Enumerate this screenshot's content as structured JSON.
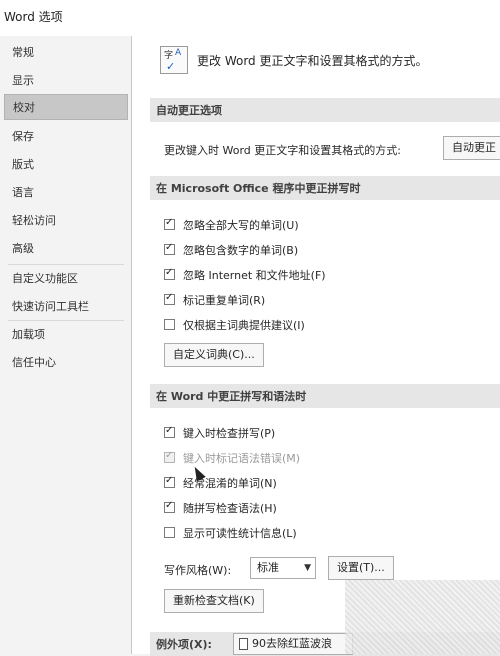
{
  "window": {
    "title": "Word 选项"
  },
  "sidebar": {
    "items": [
      {
        "label": "常规"
      },
      {
        "label": "显示"
      },
      {
        "label": "校对"
      },
      {
        "label": "保存"
      },
      {
        "label": "版式"
      },
      {
        "label": "语言"
      },
      {
        "label": "轻松访问"
      },
      {
        "label": "高级"
      },
      {
        "label": "自定义功能区"
      },
      {
        "label": "快速访问工具栏"
      },
      {
        "label": "加载项"
      },
      {
        "label": "信任中心"
      }
    ],
    "selected": "校对"
  },
  "header": {
    "text": "更改 Word 更正文字和设置其格式的方式。",
    "icon": "proofing-abc-check-icon"
  },
  "autocorrect": {
    "title": "自动更正选项",
    "description": "更改键入时 Word 更正文字和设置其格式的方式:",
    "button": "自动更正"
  },
  "office": {
    "title": "在 Microsoft Office 程序中更正拼写时",
    "options": [
      {
        "label": "忽略全部大写的单词(U)",
        "checked": true
      },
      {
        "label": "忽略包含数字的单词(B)",
        "checked": true
      },
      {
        "label": "忽略 Internet 和文件地址(F)",
        "checked": true
      },
      {
        "label": "标记重复单词(R)",
        "checked": true
      },
      {
        "label": "仅根据主词典提供建议(I)",
        "checked": false
      }
    ],
    "custom_dict_button": "自定义词典(C)..."
  },
  "word": {
    "title": "在 Word 中更正拼写和语法时",
    "options": [
      {
        "label": "键入时检查拼写(P)",
        "checked": true,
        "disabled": false
      },
      {
        "label": "键入时标记语法错误(M)",
        "checked": true,
        "disabled": true
      },
      {
        "label": "经常混淆的单词(N)",
        "checked": true,
        "disabled": false
      },
      {
        "label": "随拼写检查语法(H)",
        "checked": true,
        "disabled": false
      },
      {
        "label": "显示可读性统计信息(L)",
        "checked": false,
        "disabled": false
      }
    ],
    "style_label": "写作风格(W):",
    "style_value": "标准",
    "settings_button": "设置(T)...",
    "recheck_button": "重新检查文档(K)"
  },
  "exceptions": {
    "label": "例外项(X):",
    "document": "90去除红蓝波浪"
  }
}
